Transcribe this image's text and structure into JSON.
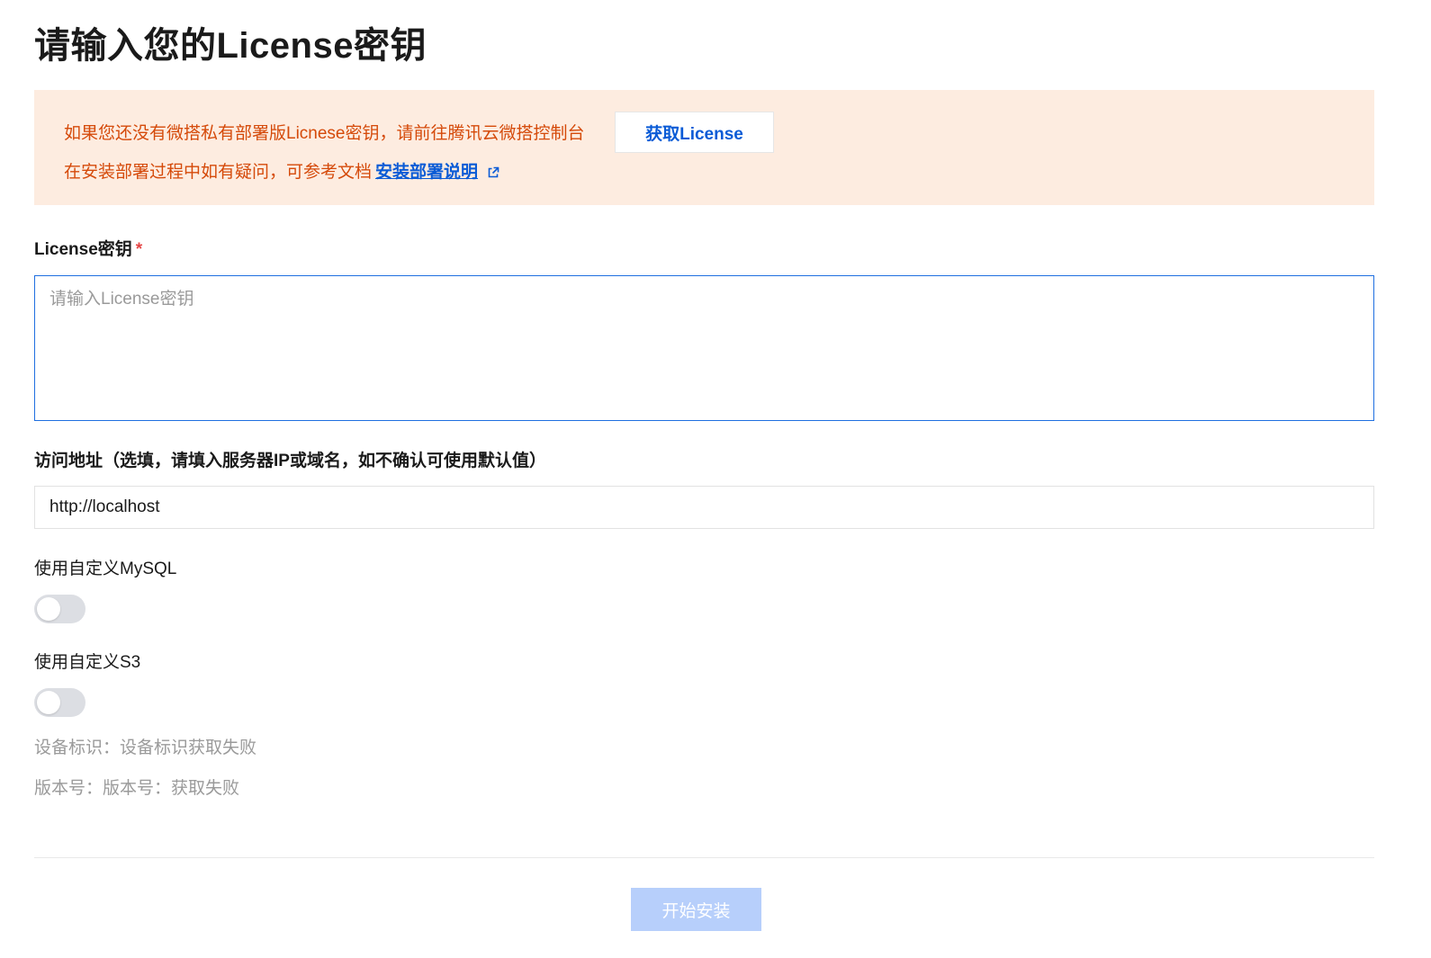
{
  "page": {
    "title": "请输入您的License密钥"
  },
  "notice": {
    "line1": "如果您还没有微搭私有部署版Licnese密钥，请前往腾讯云微搭控制台",
    "get_license_label": "获取License",
    "line2_prefix": "在安装部署过程中如有疑问，可参考文档",
    "doc_link_label": "安装部署说明",
    "link_icon": "external-link-icon"
  },
  "license_field": {
    "label": "License密钥",
    "required_mark": "*",
    "value": "",
    "placeholder": "请输入License密钥"
  },
  "url_field": {
    "label": "访问地址（选填，请填入服务器IP或域名，如不确认可使用默认值）",
    "value": "http://localhost",
    "placeholder": ""
  },
  "mysql_option": {
    "label": "使用自定义MySQL",
    "enabled": false
  },
  "s3_option": {
    "label": "使用自定义S3",
    "enabled": false
  },
  "info": {
    "device_id": "设备标识：设备标识获取失败",
    "version": "版本号：版本号：获取失败"
  },
  "footer": {
    "install_label": "开始安装"
  },
  "colors": {
    "notice_bg": "#fdece0",
    "notice_text": "#d54a0a",
    "link": "#0a5bd6",
    "input_focus_border": "#1f6fe0",
    "toggle_off": "#dcdee3",
    "install_disabled": "#b7cffb",
    "required": "#e54545"
  }
}
